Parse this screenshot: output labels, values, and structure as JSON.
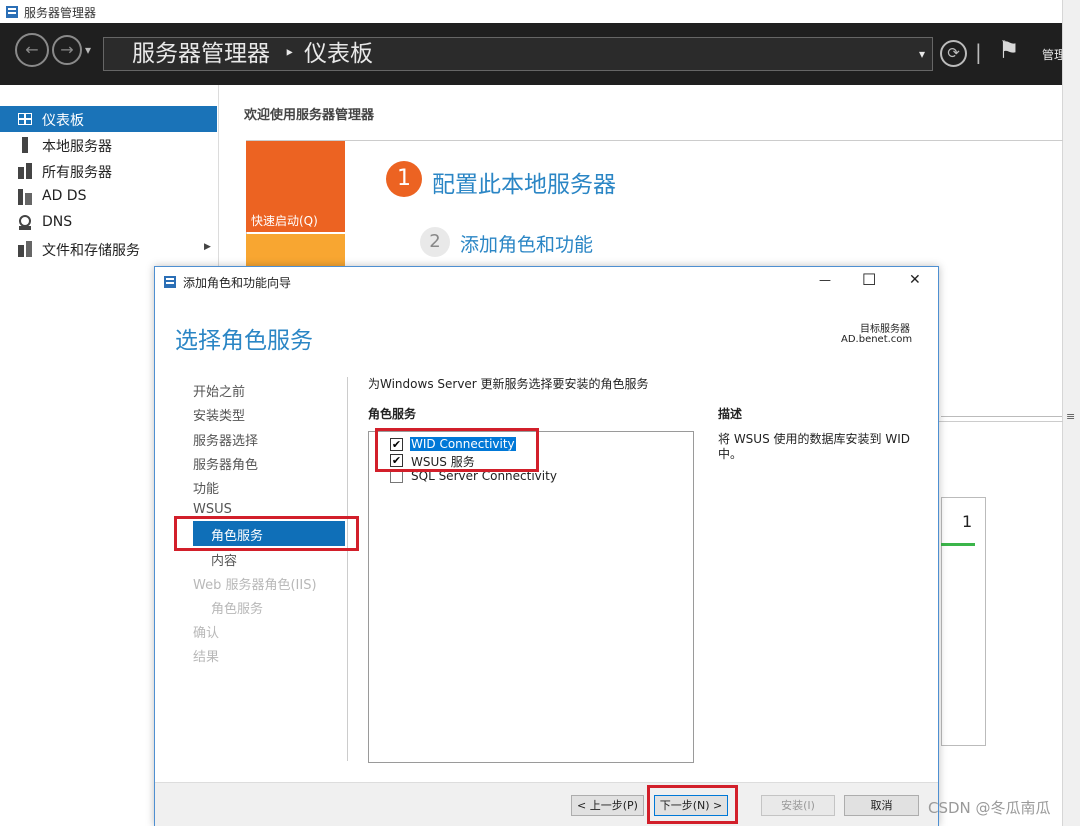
{
  "window": {
    "title": "服务器管理器"
  },
  "toolbar": {
    "back_glyph": "←",
    "forward_glyph": "→",
    "dropdown_glyph": "▾",
    "breadcrumb_root": "服务器管理器",
    "breadcrumb_sep": "‣",
    "breadcrumb_current": "仪表板",
    "breadcrumb_dropdown": "▾",
    "refresh_glyph": "⟳",
    "divider": "|",
    "flag_glyph": "⚑",
    "manage_label": "管理"
  },
  "sidebar": {
    "items": [
      {
        "label": "仪表板",
        "icon": "dashboard-icon"
      },
      {
        "label": "本地服务器",
        "icon": "server-icon"
      },
      {
        "label": "所有服务器",
        "icon": "servers-icon"
      },
      {
        "label": "AD DS",
        "icon": "adds-icon"
      },
      {
        "label": "DNS",
        "icon": "dns-icon"
      },
      {
        "label": "文件和存储服务",
        "icon": "storage-icon",
        "arrow": "▶"
      }
    ]
  },
  "main": {
    "welcome": "欢迎使用服务器管理器",
    "quick_start": "快速启动(Q)",
    "step1_num": "1",
    "step1": "配置此本地服务器",
    "step2_num": "2",
    "step2": "添加角色和功能",
    "tile_count": "1"
  },
  "dialog": {
    "title": "添加角色和功能向导",
    "minimize": "—",
    "maximize": "☐",
    "close": "✕",
    "heading": "选择角色服务",
    "target_label": "目标服务器",
    "target_value": "AD.benet.com",
    "nav": [
      {
        "label": "开始之前",
        "state": "normal"
      },
      {
        "label": "安装类型",
        "state": "normal"
      },
      {
        "label": "服务器选择",
        "state": "normal"
      },
      {
        "label": "服务器角色",
        "state": "normal"
      },
      {
        "label": "功能",
        "state": "normal"
      },
      {
        "label": "WSUS",
        "state": "normal"
      },
      {
        "label": "角色服务",
        "state": "selected"
      },
      {
        "label": "内容",
        "state": "normal"
      },
      {
        "label": "Web 服务器角色(IIS)",
        "state": "disabled"
      },
      {
        "label": "角色服务",
        "state": "disabled"
      },
      {
        "label": "确认",
        "state": "disabled"
      },
      {
        "label": "结果",
        "state": "disabled"
      }
    ],
    "intro": "为Windows Server 更新服务选择要安装的角色服务",
    "role_services_header": "角色服务",
    "description_header": "描述",
    "description": "将 WSUS 使用的数据库安装到 WID 中。",
    "role_services": [
      {
        "label": "WID Connectivity",
        "checked": true,
        "highlighted": true
      },
      {
        "label": "WSUS 服务",
        "checked": true,
        "highlighted": false
      },
      {
        "label": "SQL Server Connectivity",
        "checked": false,
        "highlighted": false
      }
    ],
    "check_glyph": "✔",
    "buttons": {
      "prev": "< 上一步(P)",
      "next": "下一步(N) >",
      "install": "安装(I)",
      "cancel": "取消"
    }
  },
  "watermark": "CSDN @冬瓜南瓜",
  "colors": {
    "accent": "#1a73b8",
    "quickstart": "#ec6322",
    "annotation": "#d21f2a"
  }
}
